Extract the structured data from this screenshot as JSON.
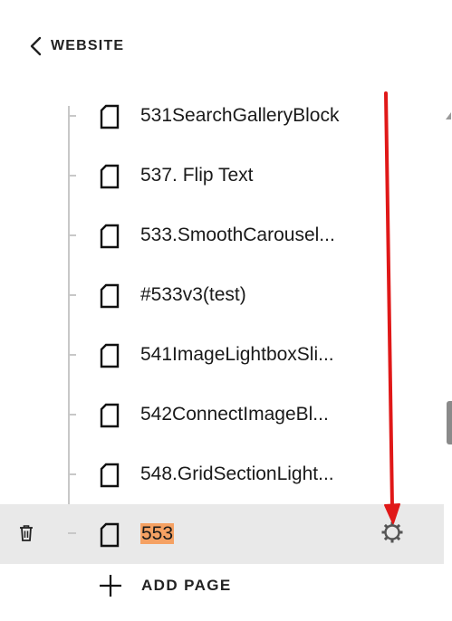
{
  "nav": {
    "back_label": "WEBSITE"
  },
  "pages": [
    {
      "label": "531SearchGalleryBlock"
    },
    {
      "label": "537. Flip Text"
    },
    {
      "label": "533.SmoothCarousel..."
    },
    {
      "label": "#533v3(test)"
    },
    {
      "label": "541ImageLightboxSli..."
    },
    {
      "label": "542ConnectImageBl..."
    },
    {
      "label": "548.GridSectionLight..."
    },
    {
      "label": "553",
      "selected": true,
      "highlight_color": "#f5a163"
    }
  ],
  "actions": {
    "add_page_label": "ADD PAGE"
  },
  "annotation": {
    "arrow_color": "#e01818"
  },
  "colors": {
    "row_active_bg": "#e9e9e9",
    "tree_line": "#c8c8c8"
  }
}
